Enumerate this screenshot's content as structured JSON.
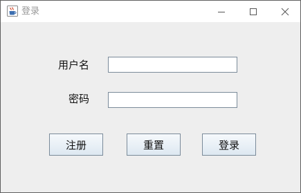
{
  "window": {
    "title": "登录",
    "app_icon": "java-coffee-cup-icon"
  },
  "window_controls": {
    "minimize_icon": "minimize-icon",
    "maximize_icon": "maximize-icon",
    "close_icon": "close-icon"
  },
  "form": {
    "username_label": "用户名",
    "username_value": "",
    "password_label": "密码",
    "password_value": ""
  },
  "buttons": {
    "register_label": "注册",
    "reset_label": "重置",
    "login_label": "登录"
  },
  "colors": {
    "window_bg": "#eeeeee",
    "titlebar_bg": "#ffffff",
    "title_text": "#999999",
    "button_border": "#7a8a99"
  }
}
